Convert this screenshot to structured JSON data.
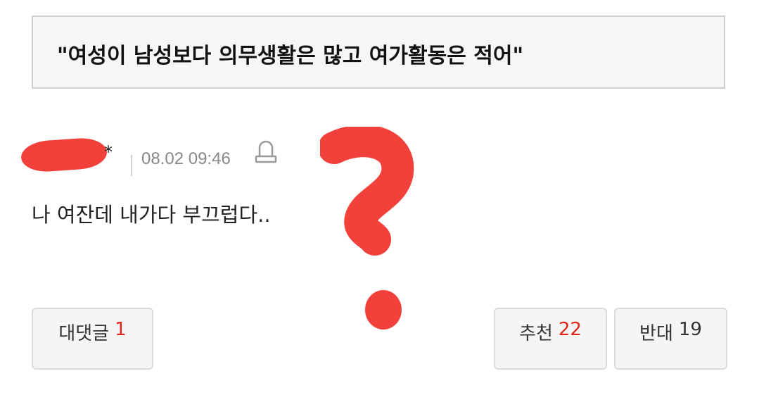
{
  "headline": "\"여성이 남성보다 의무생활은 많고 여가활동은 적어\"",
  "comment": {
    "author_suffix": "*",
    "timestamp": "08.02 09:46",
    "body": "나 여잔데 내가다 부끄럽다.."
  },
  "buttons": {
    "reply_label": "대댓글",
    "reply_count": "1",
    "recommend_label": "추천",
    "recommend_count": "22",
    "oppose_label": "반대",
    "oppose_count": "19"
  },
  "colors": {
    "accent_red": "#e0241b",
    "overlay_red": "#f2403a",
    "box_border": "#cfcfcf",
    "timestamp_gray": "#888888"
  },
  "icons": {
    "report": "bell-icon",
    "overlay": "question-mark-scribble"
  }
}
